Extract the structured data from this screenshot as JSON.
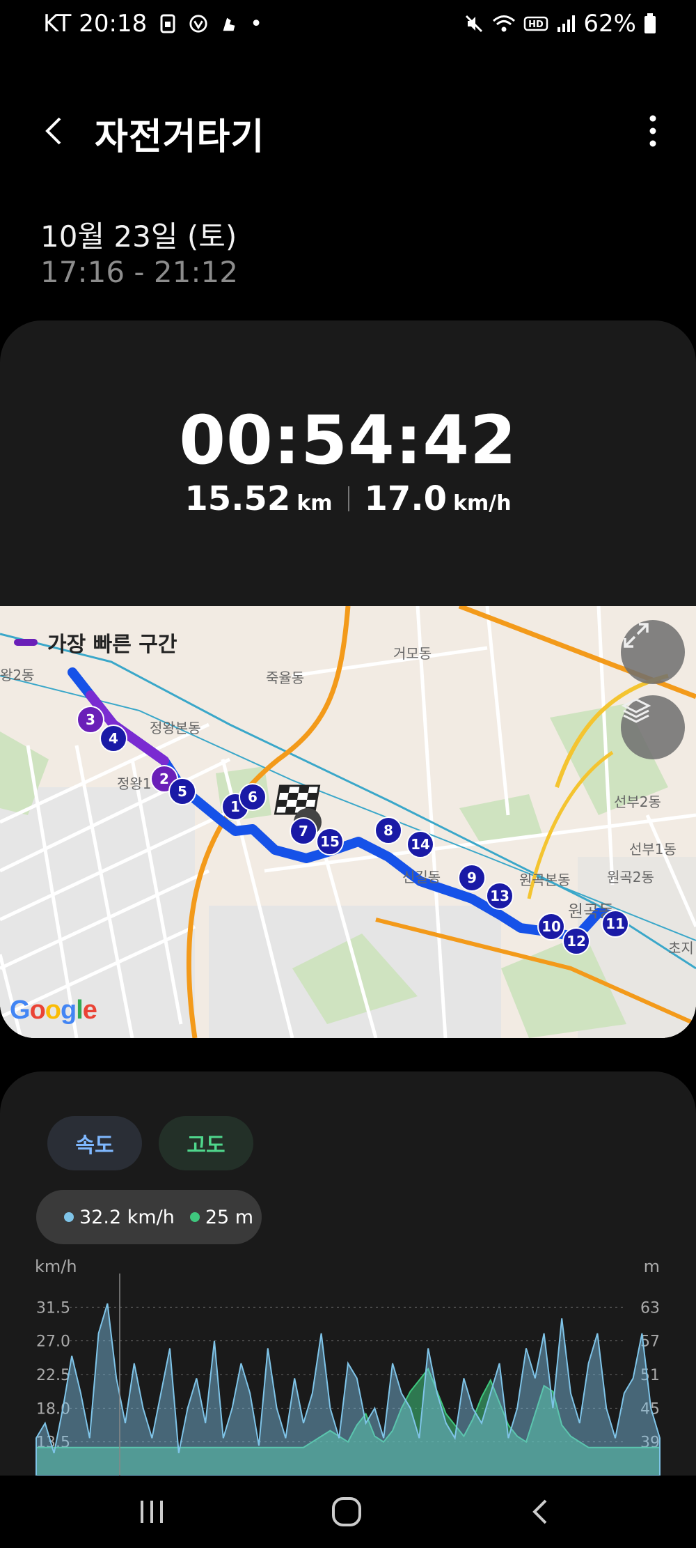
{
  "status_bar": {
    "carrier_time": "KT 20:18",
    "left_icons": [
      "sim-card-icon",
      "vi-app-icon",
      "shoe-icon",
      "dot-icon"
    ],
    "right_icons": [
      "mute-icon",
      "wifi-icon",
      "hd-voice-icon",
      "signal-icon",
      "battery-icon"
    ],
    "battery": "62%"
  },
  "header": {
    "title": "자전거타기"
  },
  "session": {
    "date": "10월 23일 (토)",
    "time_range": "17:16 - 21:12"
  },
  "summary": {
    "duration": "00:54:42",
    "distance_value": "15.52",
    "distance_unit": "km",
    "speed_value": "17.0",
    "speed_unit": "km/h"
  },
  "map": {
    "legend_label": "가장 빠른 구간",
    "google": "Google",
    "place_labels": [
      {
        "text": "거모동"
      },
      {
        "text": "죽율동"
      },
      {
        "text": "정왕본동"
      },
      {
        "text": "왕2동"
      },
      {
        "text": "정왕1"
      },
      {
        "text": "선부2동"
      },
      {
        "text": "선부1동"
      },
      {
        "text": "원곡본동"
      },
      {
        "text": "원곡2동"
      },
      {
        "text": "신길동"
      },
      {
        "text": "원곡동"
      },
      {
        "text": "초지"
      }
    ],
    "markers": [
      "1",
      "2",
      "3",
      "4",
      "5",
      "6",
      "7",
      "8",
      "9",
      "10",
      "11",
      "12",
      "13",
      "14",
      "15"
    ],
    "colors": {
      "route": "#1652e8",
      "fastest": "#7a2bd1",
      "marker": "#1a1aa6",
      "marker_fast": "#6a1fb8"
    }
  },
  "chart_card": {
    "tab_speed": "속도",
    "tab_altitude": "고도",
    "tooltip_speed": "32.2 km/h",
    "tooltip_altitude": "25 m",
    "left_unit": "km/h",
    "right_unit": "m"
  },
  "chart_data": {
    "type": "area",
    "left_ticks": [
      "31.5",
      "27.0",
      "22.5",
      "18.0",
      "13.5"
    ],
    "right_ticks": [
      "63",
      "57",
      "51",
      "45",
      "39"
    ],
    "series": [
      {
        "name": "속도",
        "unit": "km/h",
        "color": "#7fc4e8",
        "values": [
          14,
          16,
          12,
          18,
          25,
          20,
          14,
          28,
          32,
          22,
          16,
          24,
          18,
          14,
          20,
          26,
          12,
          18,
          22,
          16,
          27,
          14,
          18,
          24,
          20,
          13,
          26,
          18,
          14,
          22,
          16,
          20,
          28,
          18,
          14,
          24,
          22,
          16,
          18,
          14,
          24,
          20,
          18,
          14,
          26,
          20,
          16,
          14,
          22,
          18,
          16,
          20,
          24,
          14,
          18,
          26,
          22,
          28,
          18,
          30,
          20,
          16,
          24,
          28,
          18,
          14,
          20,
          22,
          28,
          18,
          14
        ]
      },
      {
        "name": "고도",
        "unit": "m",
        "color": "#3fc77e",
        "values": [
          38,
          38,
          38,
          38,
          38,
          38,
          38,
          38,
          38,
          38,
          38,
          38,
          38,
          38,
          38,
          38,
          38,
          38,
          38,
          38,
          38,
          38,
          38,
          38,
          38,
          38,
          38,
          38,
          38,
          38,
          38,
          39,
          40,
          41,
          40,
          39,
          42,
          44,
          40,
          39,
          41,
          45,
          48,
          50,
          52,
          48,
          44,
          42,
          40,
          43,
          47,
          50,
          46,
          42,
          40,
          39,
          44,
          49,
          48,
          42,
          40,
          39,
          38,
          38,
          38,
          38,
          38,
          38,
          38,
          38,
          38
        ]
      }
    ],
    "left_range": [
      9.0,
      36.0
    ],
    "right_range": [
      33,
      69
    ]
  },
  "nav": {
    "recents": "recents-icon",
    "home": "home-icon",
    "back": "back-icon"
  }
}
